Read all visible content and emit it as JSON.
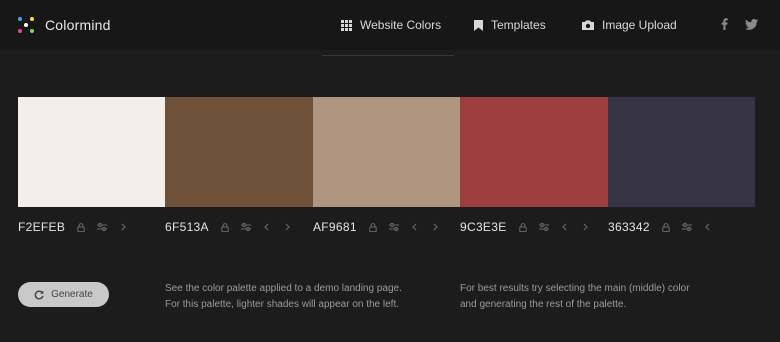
{
  "brand": {
    "name": "Colormind"
  },
  "nav": {
    "items": [
      {
        "label": "Website Colors",
        "icon": "grid-icon"
      },
      {
        "label": "Templates",
        "icon": "bookmark-icon"
      },
      {
        "label": "Image Upload",
        "icon": "camera-icon"
      }
    ],
    "active": "Website Colors"
  },
  "social": [
    {
      "icon": "facebook-icon"
    },
    {
      "icon": "twitter-icon"
    }
  ],
  "palette": [
    {
      "hex": "F2EFEB",
      "color": "#F2EFEB",
      "has_left": false,
      "has_right": true
    },
    {
      "hex": "6F513A",
      "color": "#6F513A",
      "has_left": true,
      "has_right": true
    },
    {
      "hex": "AF9681",
      "color": "#AF9681",
      "has_left": true,
      "has_right": true
    },
    {
      "hex": "9C3E3E",
      "color": "#9C3E3E",
      "has_left": true,
      "has_right": true
    },
    {
      "hex": "363342",
      "color": "#363342",
      "has_left": true,
      "has_right": false
    }
  ],
  "generate": {
    "label": "Generate"
  },
  "info": {
    "left": {
      "line1": "See the color palette applied to a demo landing page.",
      "line2": "For this palette, lighter shades will appear on the left."
    },
    "right": {
      "line1": "For best results try selecting the main (middle) color",
      "line2": "and generating the rest of the palette."
    }
  }
}
